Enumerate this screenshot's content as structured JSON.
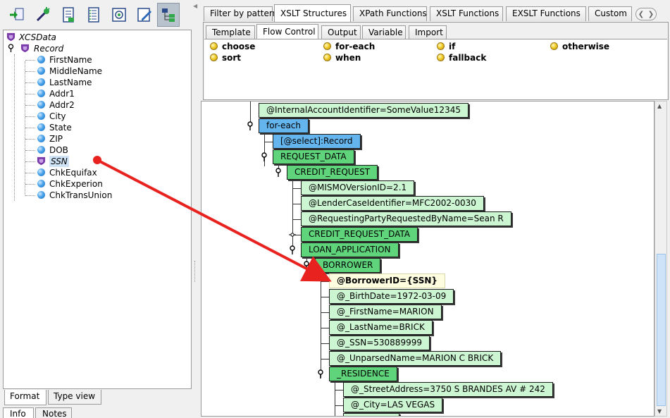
{
  "toolbar": {
    "buttons": [
      "add-node-icon",
      "wand-icon",
      "doc-list-icon",
      "doc-list2-icon",
      "preview-icon",
      "edit-icon",
      "tree-view-icon"
    ]
  },
  "schema_tree": {
    "root": "XCSData",
    "record": "Record",
    "fields": [
      "FirstName",
      "MiddleName",
      "LastName",
      "Addr1",
      "Addr2",
      "City",
      "State",
      "ZIP",
      "DOB",
      "SSN",
      "ChkEquifax",
      "ChkExperion",
      "ChkTransUnion"
    ],
    "selected": "SSN"
  },
  "left_tabs": {
    "format": "Format",
    "type_view": "Type view"
  },
  "left_tabs2": {
    "info": "Info",
    "notes": "Notes"
  },
  "top_tabs": [
    "Filter by pattern",
    "XSLT Structures",
    "XPath Functions",
    "XSLT Functions",
    "EXSLT Functions",
    "Custom"
  ],
  "active_top_tab": "XSLT Structures",
  "sub_tabs": [
    "Template",
    "Flow Control",
    "Output",
    "Variable",
    "Import"
  ],
  "active_sub_tab": "Flow Control",
  "flow_control": {
    "col1": [
      "choose",
      "sort"
    ],
    "col2": [
      "for-each",
      "when"
    ],
    "col3": [
      "if",
      "fallback"
    ],
    "col4": [
      "otherwise"
    ]
  },
  "mapping_tree": {
    "n1": "@InternalAccountIdentifier=SomeValue12345",
    "n2": "for-each",
    "n3": "[@select]:Record",
    "n4": "REQUEST_DATA",
    "n5": "CREDIT_REQUEST",
    "n6": "@MISMOVersionID=2.1",
    "n7": "@LenderCaseIdentifier=MFC2002-0030",
    "n8": "@RequestingPartyRequestedByName=Sean R",
    "n9": "CREDIT_REQUEST_DATA",
    "n10": "LOAN_APPLICATION",
    "n11": "BORROWER",
    "n12": "@BorrowerID={SSN}",
    "n13": "@_BirthDate=1972-03-09",
    "n14": "@_FirstName=MARION",
    "n15": "@_LastName=BRICK",
    "n16": "@_SSN=530889999",
    "n17": "@_UnparsedName=MARION C BRICK",
    "n18": "_RESIDENCE",
    "n19": "@_StreetAddress=3750 S BRANDES AV # 242",
    "n20": "@_City=LAS VEGAS"
  },
  "colors": {
    "attr_node": "#ccf5d1",
    "elem_node": "#5fd47a",
    "xslt_node": "#64b5ee",
    "arrow": "#e8231f"
  }
}
